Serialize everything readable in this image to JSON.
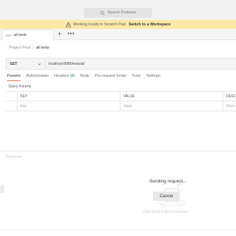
{
  "search": {
    "placeholder": "Search Postman"
  },
  "banner": {
    "text": "Working locally in Scratch Pad.",
    "link": "Switch to a Workspace"
  },
  "tab": {
    "method": "GET",
    "title": "all texts"
  },
  "toolbar": {
    "add": "+",
    "more": "•••"
  },
  "breadcrumb": {
    "project": "Project Final",
    "separator": "/",
    "current": "all texts"
  },
  "request": {
    "method": "GET",
    "url": "localhost:8080/texts/all"
  },
  "subtabs": {
    "params": "Params",
    "authorization": "Authorization",
    "headers": "Headers",
    "headers_count": "(8)",
    "body": "Body",
    "prerequest": "Pre-request Script",
    "tests": "Tests",
    "settings": "Settings"
  },
  "query_params": {
    "title": "Query Params",
    "columns": [
      "KEY",
      "VALUE",
      "DESCR"
    ],
    "placeholders": [
      "Key",
      "Value",
      "Descr"
    ]
  },
  "response": {
    "label": "Response",
    "status": "Sending request...",
    "cancel": "Cancel",
    "hint": "Click Send to get a response"
  },
  "colors": {
    "accent": "#ff6c37",
    "banner": "#fbe9a8",
    "headers_count": "#3a8c4a"
  }
}
